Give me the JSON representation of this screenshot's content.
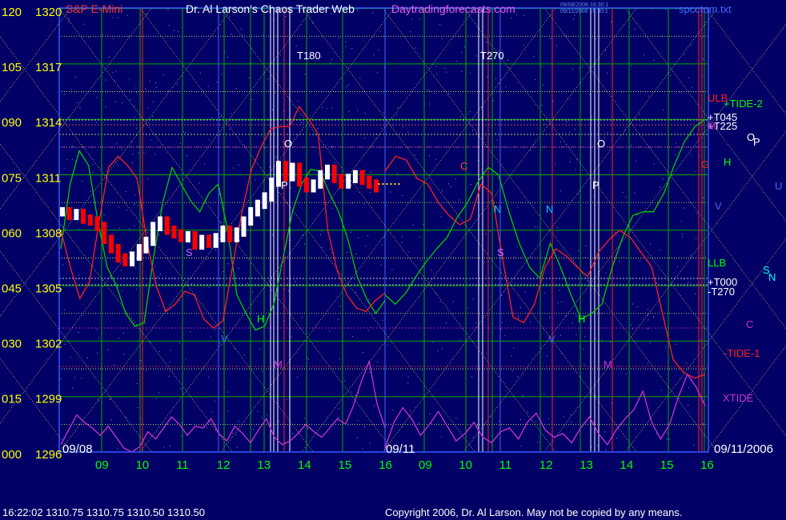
{
  "header": {
    "symbol": "S&P E-Mini",
    "title": "Dr. Al Larson's Chaos Trader Web",
    "site": "Daytradingforecasts.com",
    "stamp_line1": "09/08/2006 16:30:1",
    "stamp_line2": "09/11/2006 16:30:1",
    "filename": "spcctom.txt"
  },
  "footer": {
    "quote": "16:22:02  1310.75  1310.75  1310.50  1310.50",
    "copyright": "Copyright 2006, Dr. Al Larson. May not be copied by any means."
  },
  "colors": {
    "background": "#000066",
    "price_up": "#ffffff",
    "price_down": "#ff0000",
    "grid_green": "#00aa00",
    "grid_yellow": "#ffff66",
    "tide2": "#00cc00",
    "tide1": "#ff2020",
    "xtide": "#cc33cc",
    "axis_text": "#ffff00",
    "hour_text": "#00ff00"
  },
  "chart_data": {
    "type": "line",
    "title": "S&P E-Mini",
    "y_left_labels": [
      "120",
      "105",
      "090",
      "075",
      "060",
      "045",
      "030",
      "015",
      "000"
    ],
    "y_right_labels": [
      "1320",
      "1317",
      "1314",
      "1311",
      "1308",
      "1305",
      "1302",
      "1299",
      "1296"
    ],
    "ylim": [
      1296,
      1320
    ],
    "days": [
      {
        "date": "09/08",
        "hours": [
          "09",
          "10",
          "11",
          "12",
          "13",
          "14",
          "15",
          "16"
        ]
      },
      {
        "date": "09/11",
        "hours": [
          "09",
          "10",
          "11",
          "12",
          "13",
          "14",
          "15",
          "16"
        ]
      }
    ],
    "end_date": "09/11/2006",
    "time_labels": [
      "T180",
      "T270"
    ],
    "right_labels": [
      {
        "text": "+TIDE-2",
        "color": "#00ff00"
      },
      {
        "text": "ULB",
        "color": "#ff2020"
      },
      {
        "text": "+T045",
        "color": "#ffffff"
      },
      {
        "text": "+T225",
        "color": "#ffffff"
      },
      {
        "text": "M",
        "color": "#cc33cc"
      },
      {
        "text": "O",
        "color": "#ffffff"
      },
      {
        "text": "P",
        "color": "#ffffff"
      },
      {
        "text": "H",
        "color": "#00ff00"
      },
      {
        "text": "G",
        "color": "#ff2020"
      },
      {
        "text": "V",
        "color": "#4466ff"
      },
      {
        "text": "U",
        "color": "#4466ff"
      },
      {
        "text": "LLB",
        "color": "#00ff00"
      },
      {
        "text": "+T000",
        "color": "#ffffff"
      },
      {
        "text": "-T270",
        "color": "#ffffff"
      },
      {
        "text": "S",
        "color": "#00ffff"
      },
      {
        "text": "N",
        "color": "#00ffff"
      },
      {
        "text": "C",
        "color": "#cc33cc"
      },
      {
        "text": "-TIDE-1",
        "color": "#ff2020"
      },
      {
        "text": "XTIDE",
        "color": "#cc33cc"
      }
    ],
    "price_series": {
      "name": "S&P E-Mini",
      "day1": [
        1309.0,
        1308.8,
        1308.9,
        1308.6,
        1308.5,
        1308.2,
        1307.5,
        1307.0,
        1306.5,
        1306.3,
        1306.6,
        1307.0,
        1307.4,
        1308.2,
        1308.5,
        1308.0,
        1307.8,
        1307.6,
        1307.7,
        1307.2,
        1307.5,
        1307.3,
        1307.6,
        1308.0,
        1307.6,
        1307.9,
        1308.5,
        1309.0,
        1309.4,
        1309.8,
        1310.6,
        1311.5,
        1310.9,
        1311.4,
        1310.6,
        1310.3,
        1310.5,
        1311.0,
        1311.3,
        1310.8,
        1310.5,
        1310.8,
        1311.0,
        1310.7,
        1310.5,
        1310.3
      ],
      "day2_last": 1310.5
    },
    "tide2": {
      "name": "+TIDE-2",
      "day1": [
        1307.0,
        1310.5,
        1312.3,
        1311.5,
        1308.5,
        1306.0,
        1305.0,
        1303.5,
        1302.8,
        1303.0,
        1306.5,
        1309.5,
        1311.4,
        1310.5,
        1309.6,
        1309.0,
        1310.0,
        1310.5,
        1308.0,
        1304.5,
        1303.5,
        1302.6,
        1302.8,
        1304.0,
        1306.5,
        1309.0,
        1310.5,
        1311.3,
        1311.2,
        1310.0,
        1309.0,
        1307.5,
        1305.5,
        1304.3,
        1303.5,
        1304.2
      ],
      "day2": [
        1304.5,
        1304.0,
        1304.6,
        1305.5,
        1306.3,
        1307.0,
        1307.6,
        1308.7,
        1309.5,
        1310.6,
        1311.4,
        1311.0,
        1309.0,
        1307.3,
        1306.0,
        1305.4,
        1307.3,
        1306.0,
        1304.5,
        1303.2,
        1303.5,
        1304.0,
        1306.0,
        1307.6,
        1308.8,
        1309.0,
        1309.0,
        1310.0,
        1311.5,
        1312.8,
        1313.6,
        1314.0
      ]
    },
    "tide1": {
      "name": "-TIDE-1",
      "day1": [
        1308.0,
        1306.0,
        1304.3,
        1305.2,
        1308.4,
        1311.4,
        1312.0,
        1311.5,
        1310.8,
        1307.5,
        1305.0,
        1303.6,
        1304.0,
        1304.7,
        1304.5,
        1303.2,
        1302.7,
        1303.1,
        1306.0,
        1309.0,
        1311.3,
        1312.5,
        1313.5,
        1313.6,
        1313.6,
        1314.7,
        1314.0,
        1313.2,
        1308.0,
        1305.8,
        1304.5,
        1303.8,
        1303.6,
        1304.2,
        1304.6
      ],
      "day2": [
        1311.2,
        1312.0,
        1311.8,
        1310.8,
        1310.5,
        1309.5,
        1308.8,
        1308.3,
        1308.6,
        1310.5,
        1310.0,
        1306.5,
        1303.3,
        1303.0,
        1304.0,
        1306.0,
        1307.0,
        1306.6,
        1306.0,
        1305.5,
        1306.8,
        1307.5,
        1308.0,
        1307.6,
        1306.8,
        1306.0,
        1303.5,
        1301.0,
        1300.3,
        1300.0,
        1300.2
      ]
    },
    "xtide": {
      "name": "XTIDE",
      "day1": [
        1296.4,
        1297.2,
        1298.0,
        1297.6,
        1297.3,
        1296.9,
        1297.4,
        1296.8,
        1296.2,
        1296.0,
        1296.3,
        1297.1,
        1296.7,
        1297.3,
        1297.9,
        1297.5,
        1296.9,
        1297.4,
        1297.3,
        1297.8,
        1297.0,
        1296.6,
        1297.4,
        1297.0,
        1296.5,
        1297.2,
        1297.8,
        1296.8,
        1296.4,
        1296.6,
        1297.0,
        1297.5,
        1297.1,
        1296.8,
        1297.3,
        1297.8,
        1297.5,
        1298.5,
        1299.8,
        1300.9,
        1298.6,
        1297.3
      ],
      "day2": [
        1296.2,
        1297.6,
        1298.4,
        1297.8,
        1296.9,
        1297.5,
        1298.2,
        1297.4,
        1296.6,
        1297.0,
        1297.6,
        1296.8,
        1296.5,
        1297.1,
        1297.3,
        1296.7,
        1297.6,
        1298.1,
        1297.2,
        1296.8,
        1297.0,
        1296.5,
        1297.3,
        1297.9,
        1297.0,
        1296.4,
        1297.2,
        1297.8,
        1298.3,
        1299.3,
        1297.6,
        1296.7,
        1297.5,
        1299.0,
        1300.2,
        1299.5,
        1298.5
      ]
    },
    "grid": true,
    "legend": "right"
  }
}
